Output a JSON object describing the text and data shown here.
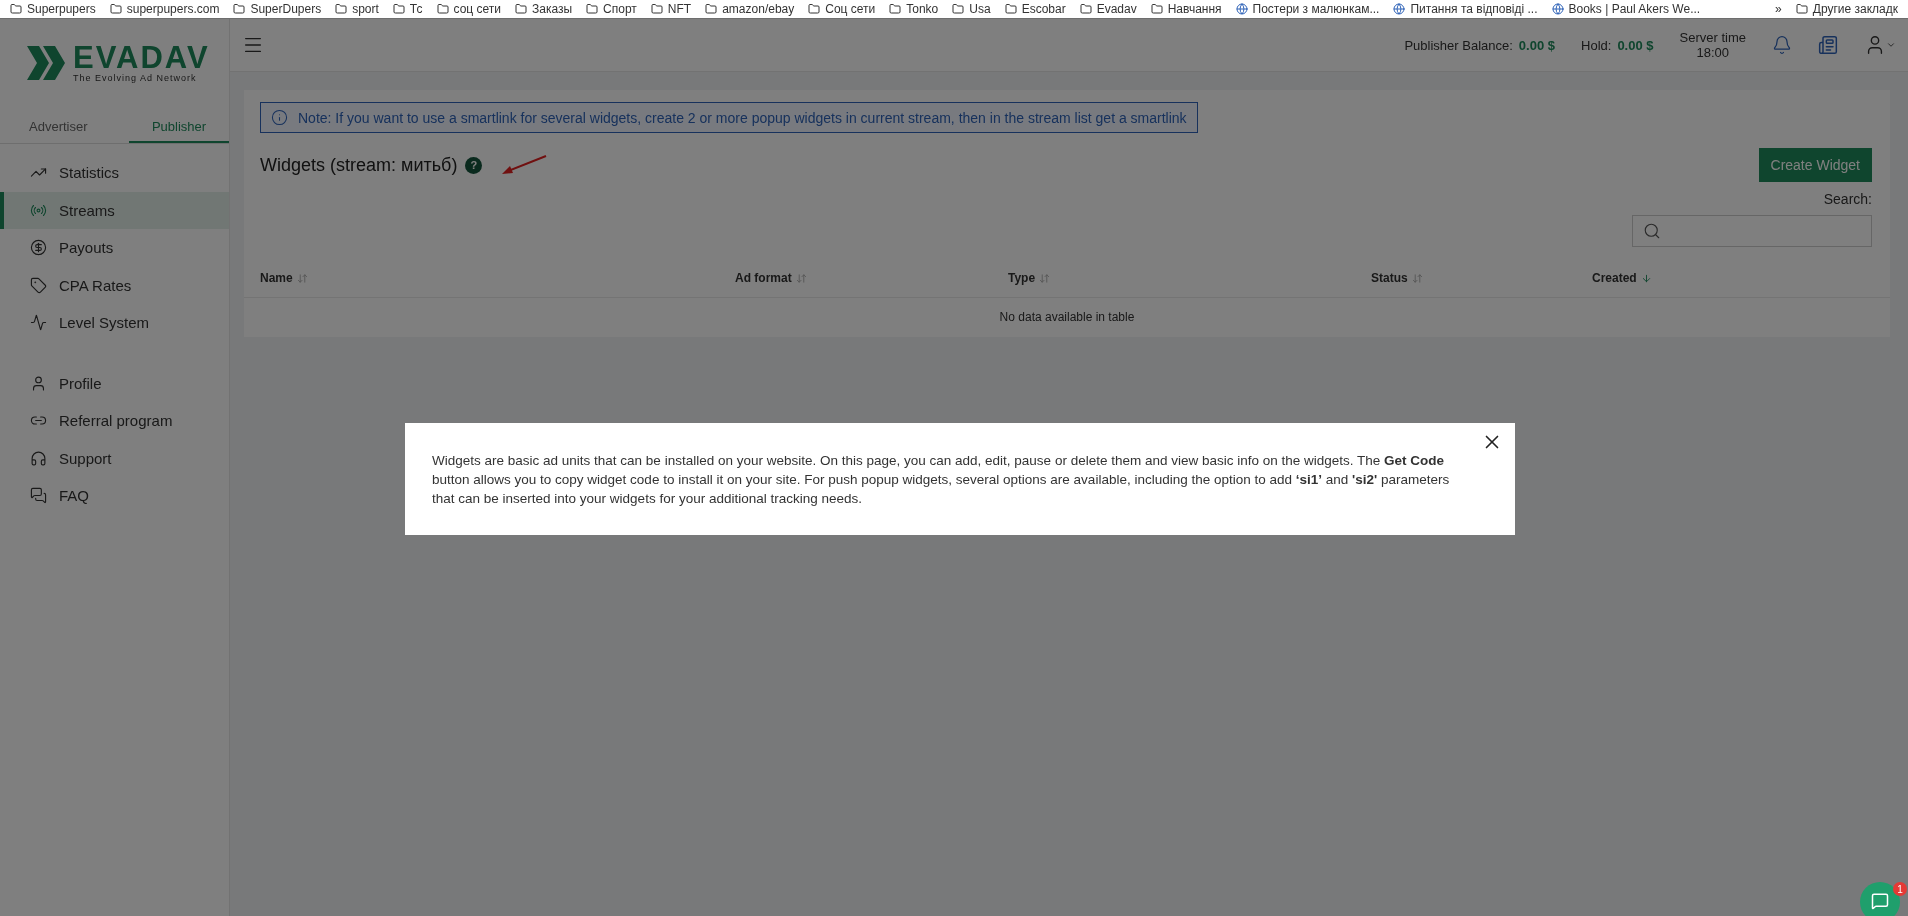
{
  "bookmarks": [
    {
      "label": "Superpupers",
      "kind": "folder"
    },
    {
      "label": "superpupers.com",
      "kind": "folder"
    },
    {
      "label": "SuperDupers",
      "kind": "folder"
    },
    {
      "label": "sport",
      "kind": "folder"
    },
    {
      "label": "Тс",
      "kind": "folder"
    },
    {
      "label": "соц сети",
      "kind": "folder"
    },
    {
      "label": "Заказы",
      "kind": "folder"
    },
    {
      "label": "Спорт",
      "kind": "folder"
    },
    {
      "label": "NFT",
      "kind": "folder"
    },
    {
      "label": "amazon/ebay",
      "kind": "folder"
    },
    {
      "label": "Соц сети",
      "kind": "folder"
    },
    {
      "label": "Tonko",
      "kind": "folder"
    },
    {
      "label": "Usa",
      "kind": "folder"
    },
    {
      "label": "Escobar",
      "kind": "folder"
    },
    {
      "label": "Evadav",
      "kind": "folder"
    },
    {
      "label": "Навчання",
      "kind": "folder"
    },
    {
      "label": "Постери з малюнкам...",
      "kind": "site"
    },
    {
      "label": "Питання та відповіді ...",
      "kind": "site"
    },
    {
      "label": "Books | Paul Akers We...",
      "kind": "site"
    }
  ],
  "bookmarks_more": "»",
  "other_bookmarks": "Другие закладк",
  "logo": {
    "name": "EVADAV",
    "tagline": "The Evolving Ad Network"
  },
  "role_tabs": [
    {
      "label": "Advertiser",
      "selected": false
    },
    {
      "label": "Publisher",
      "selected": true
    }
  ],
  "sidebar": {
    "items": [
      {
        "label": "Statistics",
        "selected": false
      },
      {
        "label": "Streams",
        "selected": true
      },
      {
        "label": "Payouts",
        "selected": false
      },
      {
        "label": "CPA Rates",
        "selected": false
      },
      {
        "label": "Level System",
        "selected": false
      },
      {
        "label": "Profile",
        "selected": false
      },
      {
        "label": "Referral program",
        "selected": false
      },
      {
        "label": "Support",
        "selected": false
      },
      {
        "label": "FAQ",
        "selected": false
      }
    ]
  },
  "header": {
    "balance_label": "Publisher Balance:",
    "balance_value": "0.00 $",
    "hold_label": "Hold:",
    "hold_value": "0.00 $",
    "server_time_label": "Server time",
    "server_time": "18:00"
  },
  "note": "Note: If you want to use a smartlink for several widgets, create 2 or more popup widgets in current stream, then in the stream list get a smartlink",
  "page_title": "Widgets (stream: митьб)",
  "help_mark": "?",
  "create_button": "Create Widget",
  "search_label": "Search:",
  "table": {
    "columns": [
      {
        "label": "Name",
        "sorted": false
      },
      {
        "label": "Ad format",
        "sorted": false
      },
      {
        "label": "Type",
        "sorted": false
      },
      {
        "label": "Status",
        "sorted": false
      },
      {
        "label": "Created",
        "sorted": true
      }
    ],
    "empty": "No data available in table"
  },
  "modal": {
    "text": "Widgets are basic ad units that can be installed on your website. On this page, you can add, edit, pause or delete them and view basic info on the widgets. The **Get Code** button allows you to copy widget code to install it on your site. For push popup widgets, several options are available, including the option to add **‘si1’** and **'si2'** parameters that can be inserted into your widgets for your additional tracking needs."
  },
  "chat_badge": "1"
}
